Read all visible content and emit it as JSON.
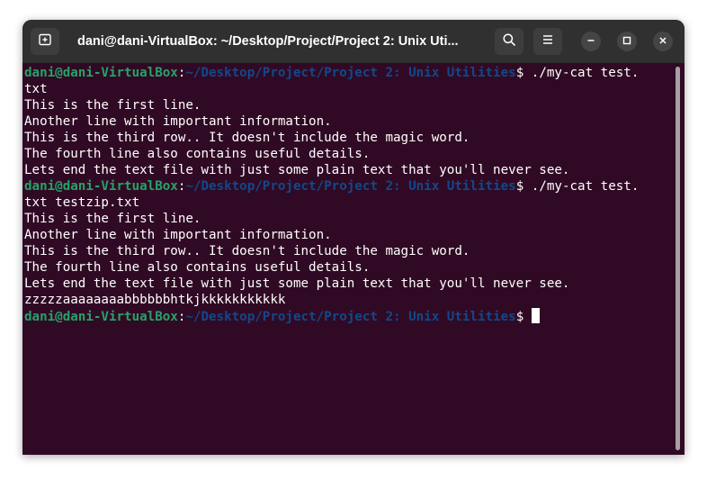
{
  "window": {
    "title": "dani@dani-VirtualBox: ~/Desktop/Project/Project 2: Unix Uti..."
  },
  "icons": {
    "new_tab": "new-tab-icon",
    "search": "search-icon",
    "menu": "hamburger-menu-icon",
    "minimize": "minimize-icon",
    "maximize": "maximize-icon",
    "close": "close-icon"
  },
  "colors": {
    "terminal_bg": "#300a24",
    "titlebar_bg": "#303030",
    "prompt_user": "#26a269",
    "prompt_path": "#12488b",
    "text": "#ffffff"
  },
  "prompt": {
    "user": "dani@dani-VirtualBox",
    "sep": ":",
    "path": "~/Desktop/Project/Project 2: Unix Utilities",
    "symbol": "$ "
  },
  "terminal": {
    "cmd1": {
      "command": "./my-cat test.",
      "wrap": "txt"
    },
    "out1": [
      "This is the first line.",
      "Another line with important information.",
      "This is the third row.. It doesn't include the magic word.",
      "The fourth line also contains useful details.",
      "Lets end the text file with just some plain text that you'll never see."
    ],
    "cmd2": {
      "command": "./my-cat test.",
      "wrap": "txt testzip.txt"
    },
    "out2": [
      "This is the first line.",
      "Another line with important information.",
      "This is the third row.. It doesn't include the magic word.",
      "The fourth line also contains useful details.",
      "Lets end the text file with just some plain text that you'll never see.",
      "zzzzzaaaaaaaabbbbbbhtkjkkkkkkkkkkk"
    ]
  }
}
